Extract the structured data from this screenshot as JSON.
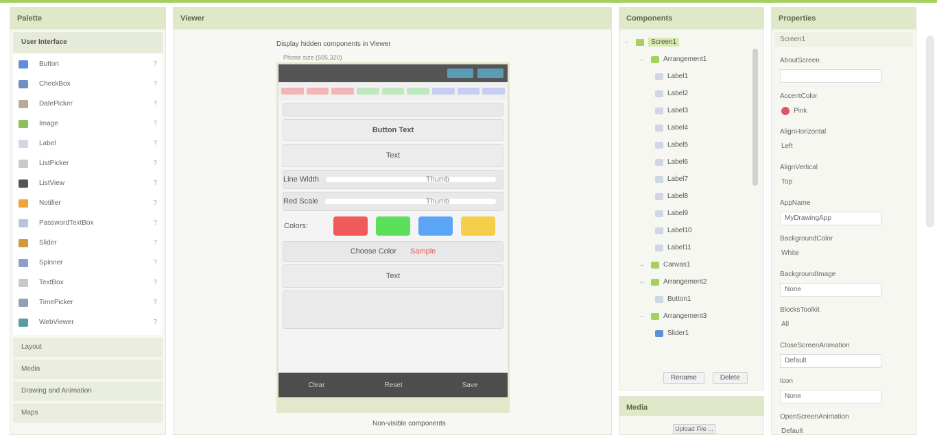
{
  "palette": {
    "title": "Palette",
    "category": "User Interface",
    "items": [
      {
        "label": "Button",
        "color": "#5d8fd6",
        "icon": "button-icon"
      },
      {
        "label": "CheckBox",
        "color": "#6f8fc2",
        "icon": "checkbox-icon"
      },
      {
        "label": "DatePicker",
        "color": "#b9aa98",
        "icon": "datepicker-icon"
      },
      {
        "label": "Image",
        "color": "#8cc05a",
        "icon": "image-icon"
      },
      {
        "label": "Label",
        "color": "#cfd6e6",
        "icon": "label-icon"
      },
      {
        "label": "ListPicker",
        "color": "#c9c9c9",
        "icon": "listpicker-icon"
      },
      {
        "label": "ListView",
        "color": "#555555",
        "icon": "listview-icon"
      },
      {
        "label": "Notifier",
        "color": "#f0a43a",
        "icon": "notifier-icon"
      },
      {
        "label": "PasswordTextBox",
        "color": "#b9c3dc",
        "icon": "password-icon"
      },
      {
        "label": "Slider",
        "color": "#d29a3c",
        "icon": "slider-icon"
      },
      {
        "label": "Spinner",
        "color": "#8aa0c8",
        "icon": "spinner-icon"
      },
      {
        "label": "TextBox",
        "color": "#c8c8c8",
        "icon": "textbox-icon"
      },
      {
        "label": "TimePicker",
        "color": "#8fa0b4",
        "icon": "timepicker-icon"
      },
      {
        "label": "WebViewer",
        "color": "#5a9aa5",
        "icon": "webviewer-icon"
      }
    ],
    "other_categories": [
      "Layout",
      "Media",
      "Drawing and Animation",
      "Maps"
    ],
    "help": "?"
  },
  "viewer": {
    "title": "Viewer",
    "subtitle": "Display hidden components in Viewer",
    "subtitle2": "Phone size (505,320)",
    "rows": {
      "row1_label": "",
      "button1": "Button Text",
      "button2": "Text",
      "slider1_label": "Line Width",
      "slider1_value": "Thumb",
      "slider2_label": "Red Scale",
      "slider2_value": "Thumb",
      "colors_label": "Colors:",
      "choose_label": "Choose Color",
      "choose_value": "Sample",
      "button3": "Text"
    },
    "bottom": [
      "Clear",
      "Reset",
      "Save"
    ],
    "footer": "Non-visible components"
  },
  "components": {
    "title": "Components",
    "tree": [
      {
        "label": "Screen1",
        "level": 0,
        "color": "#a5cf5f",
        "icon": "screen-icon"
      },
      {
        "label": "Arrangement1",
        "level": 1,
        "color": "#a5cf5f",
        "icon": "arrangement-icon"
      },
      {
        "label": "Label1",
        "level": 2,
        "color": "#cfd6e6",
        "icon": "label-icon"
      },
      {
        "label": "Label2",
        "level": 2,
        "color": "#cfd6e6",
        "icon": "label-icon"
      },
      {
        "label": "Label3",
        "level": 2,
        "color": "#cfd6e6",
        "icon": "label-icon"
      },
      {
        "label": "Label4",
        "level": 2,
        "color": "#cfd6e6",
        "icon": "label-icon"
      },
      {
        "label": "Label5",
        "level": 2,
        "color": "#cfd6e6",
        "icon": "label-icon"
      },
      {
        "label": "Label6",
        "level": 2,
        "color": "#cfd6e6",
        "icon": "label-icon"
      },
      {
        "label": "Label7",
        "level": 2,
        "color": "#cfd6e6",
        "icon": "label-icon"
      },
      {
        "label": "Label8",
        "level": 2,
        "color": "#cfd6e6",
        "icon": "label-icon"
      },
      {
        "label": "Label9",
        "level": 2,
        "color": "#cfd6e6",
        "icon": "label-icon"
      },
      {
        "label": "Label10",
        "level": 2,
        "color": "#cfd6e6",
        "icon": "label-icon"
      },
      {
        "label": "Label11",
        "level": 2,
        "color": "#cfd6e6",
        "icon": "label-icon"
      },
      {
        "label": "Canvas1",
        "level": 1,
        "color": "#a5cf5f",
        "icon": "canvas-icon"
      },
      {
        "label": "Arrangement2",
        "level": 1,
        "color": "#a5cf5f",
        "icon": "arrangement-icon"
      },
      {
        "label": "Button1",
        "level": 2,
        "color": "#cfd6e6",
        "icon": "button-icon"
      },
      {
        "label": "Arrangement3",
        "level": 1,
        "color": "#a5cf5f",
        "icon": "arrangement-icon"
      },
      {
        "label": "Slider1",
        "level": 2,
        "color": "#5d8fd6",
        "icon": "slider-icon"
      }
    ],
    "rename_label": "Rename",
    "delete_label": "Delete"
  },
  "media": {
    "title": "Media",
    "upload_label": "Upload File ..."
  },
  "properties": {
    "title": "Properties",
    "component_name": "Screen1",
    "items": [
      {
        "label": "AboutScreen",
        "value": "",
        "kind": "text"
      },
      {
        "label": "AccentColor",
        "value": "Pink",
        "kind": "color"
      },
      {
        "label": "AlignHorizontal",
        "value": "Left",
        "kind": "small"
      },
      {
        "label": "AlignVertical",
        "value": "Top",
        "kind": "small"
      },
      {
        "label": "AppName",
        "value": "MyDrawingApp",
        "kind": "text"
      },
      {
        "label": "BackgroundColor",
        "value": "White",
        "kind": "small"
      },
      {
        "label": "BackgroundImage",
        "value": "None",
        "kind": "text"
      },
      {
        "label": "BlocksToolkit",
        "value": "All",
        "kind": "small"
      },
      {
        "label": "CloseScreenAnimation",
        "value": "Default",
        "kind": "text"
      },
      {
        "label": "Icon",
        "value": "None",
        "kind": "text"
      },
      {
        "label": "OpenScreenAnimation",
        "value": "Default",
        "kind": "small"
      }
    ]
  }
}
